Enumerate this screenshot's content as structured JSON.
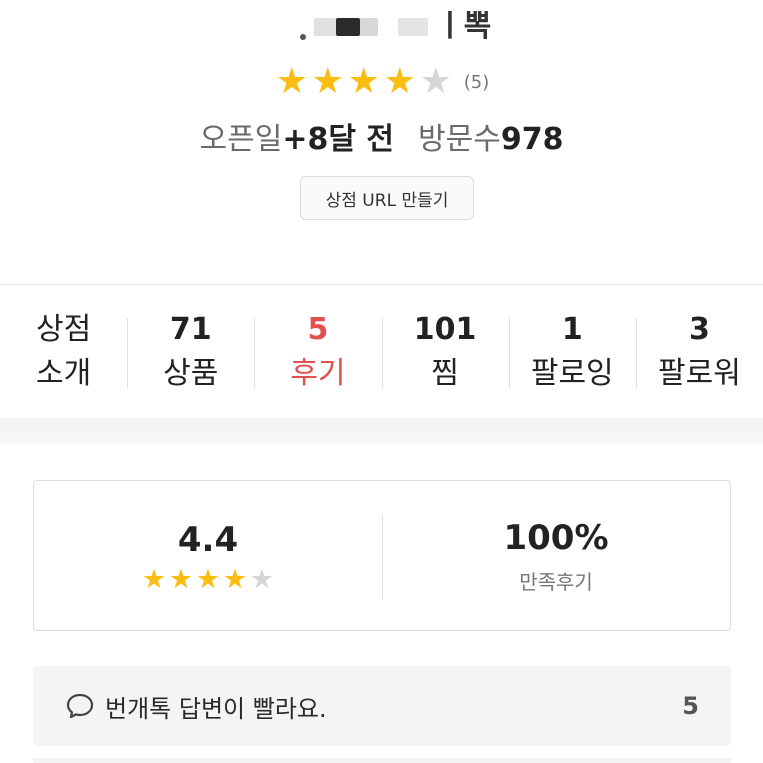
{
  "shop": {
    "name_visible_part": "ㅣ뽁",
    "rating_count": "(5)",
    "stars_filled": 4,
    "stars_total": 5,
    "open_label": "오픈일",
    "open_value": "+8달 전",
    "visit_label": "방문수",
    "visit_value": "978",
    "url_button": "상점 URL 만들기"
  },
  "tabs": [
    {
      "line1": "상점",
      "line2": "소개"
    },
    {
      "count": "71",
      "label": "상품"
    },
    {
      "count": "5",
      "label": "후기",
      "active": true
    },
    {
      "count": "101",
      "label": "찜"
    },
    {
      "count": "1",
      "label": "팔로잉"
    },
    {
      "count": "3",
      "label": "팔로워"
    }
  ],
  "summary": {
    "average": "4.4",
    "average_stars_filled": 4,
    "satisfaction": "100%",
    "satisfaction_caption": "만족후기"
  },
  "review_tag": {
    "icon": "speech-bubble-icon",
    "text": "번개톡 답변이 빨라요.",
    "count": "5"
  },
  "colors": {
    "star": "#fcbd12",
    "star_off": "#d6d6d6",
    "active_tab": "#e25050"
  }
}
